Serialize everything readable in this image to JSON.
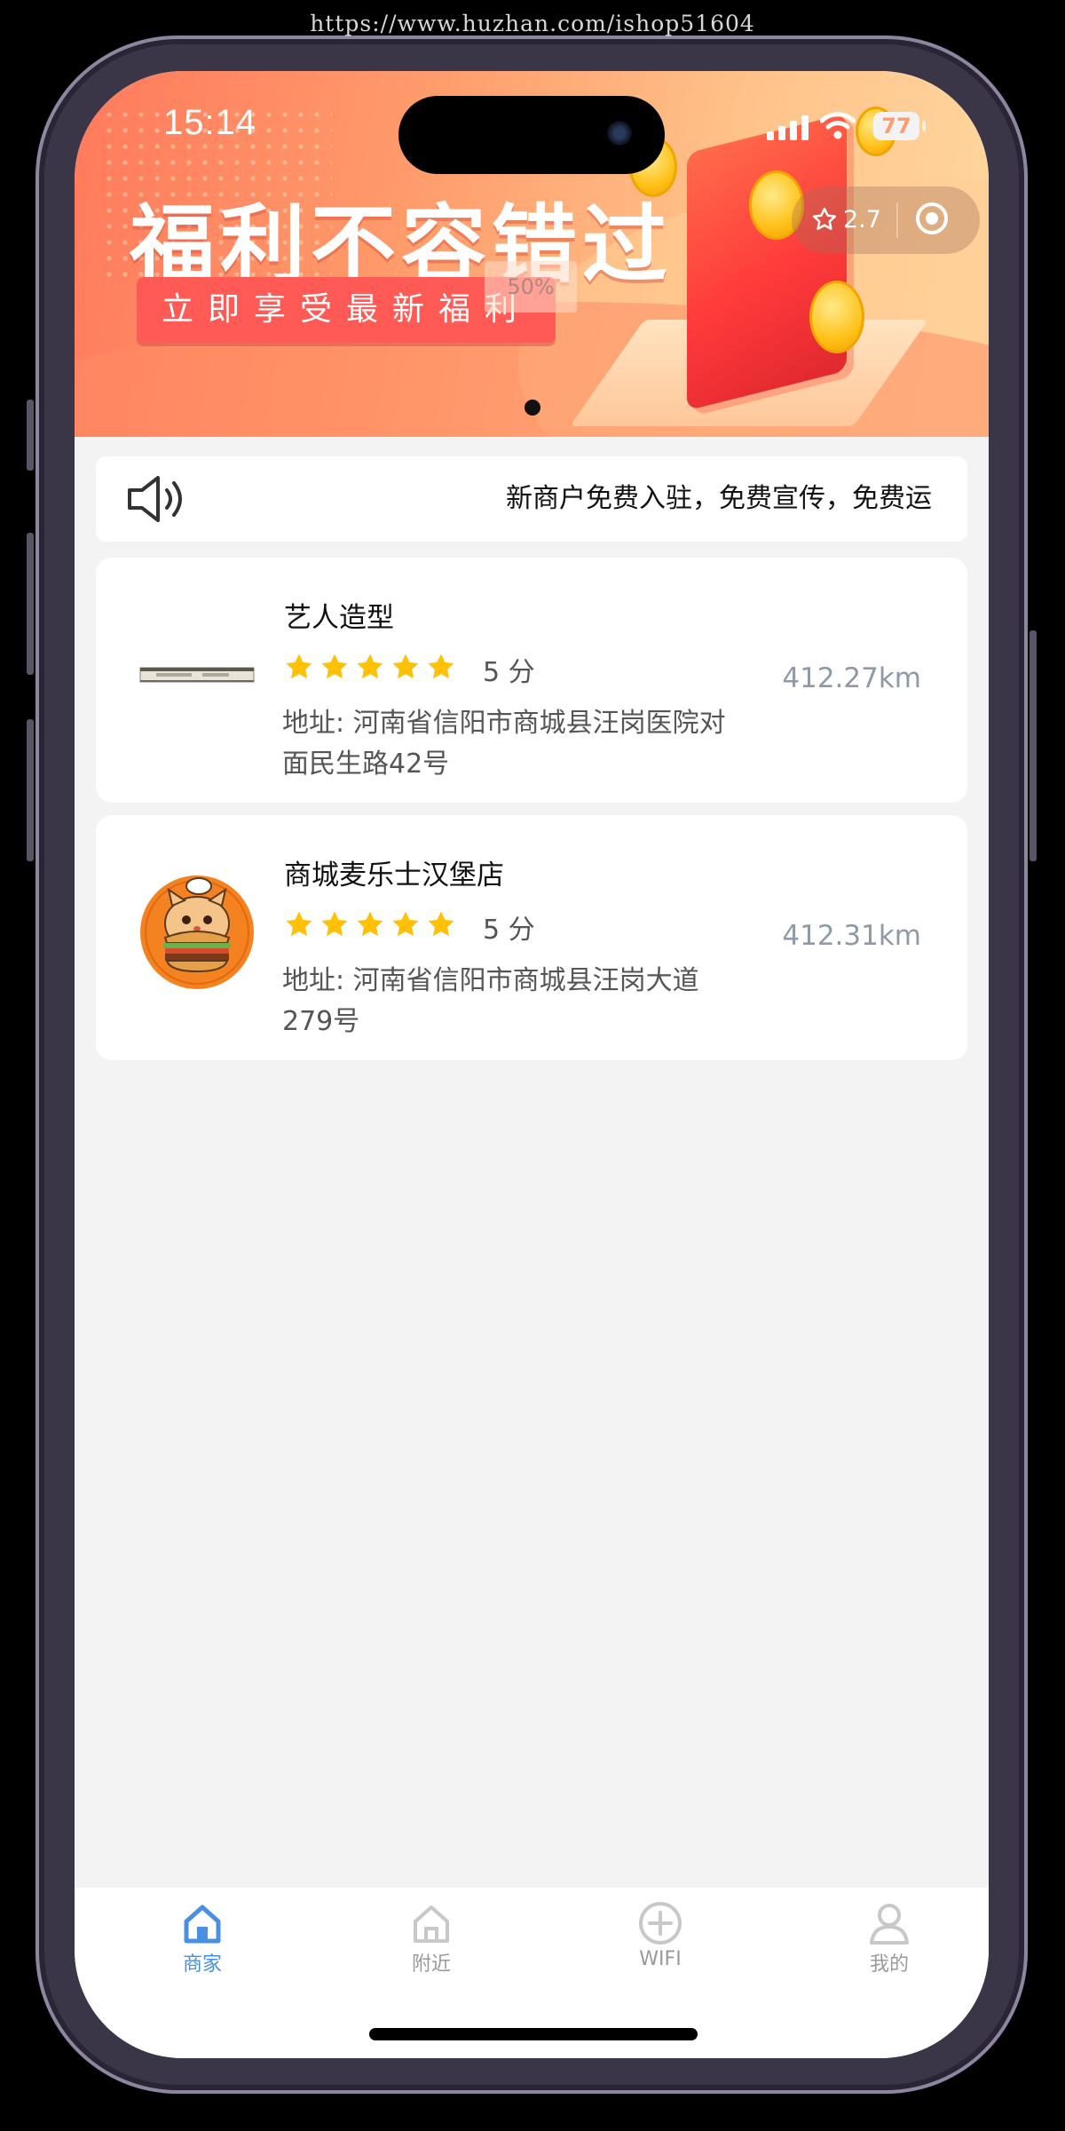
{
  "watermark": "https://www.huzhan.com/ishop51604",
  "status_bar": {
    "time": "15:14",
    "battery": "77"
  },
  "banner": {
    "title": "福利不容错过",
    "subtitle": "立即享受最新福利",
    "progress": "50%",
    "carousel_index": 1,
    "carousel_count": 1
  },
  "capsule": {
    "rating": "2.7"
  },
  "notice": {
    "text": "新商户免费入驻，免费宣传，免费运"
  },
  "merchants": [
    {
      "name": "艺人造型",
      "stars": 5,
      "score": "5 分",
      "address": "地址: 河南省信阳市商城县汪岗医院对面民生路42号",
      "distance": "412.27km",
      "thumb_icon": "shop-thumbnail"
    },
    {
      "name": "商城麦乐士汉堡店",
      "stars": 5,
      "score": "5 分",
      "address": "地址: 河南省信阳市商城县汪岗大道279号",
      "distance": "412.31km",
      "thumb_icon": "burger-cat-logo"
    }
  ],
  "tabbar": {
    "tabs": [
      {
        "label": "商家",
        "icon": "home-icon",
        "active": true
      },
      {
        "label": "附近",
        "icon": "home-outline-icon",
        "active": false
      },
      {
        "label": "WIFI",
        "icon": "plus-circle-icon",
        "active": false
      },
      {
        "label": "我的",
        "icon": "user-icon",
        "active": false
      }
    ]
  },
  "colors": {
    "accent": "#4a90e2",
    "star": "#ffc107",
    "banner_red": "#ff5a55",
    "distance": "#8e9aa7"
  }
}
